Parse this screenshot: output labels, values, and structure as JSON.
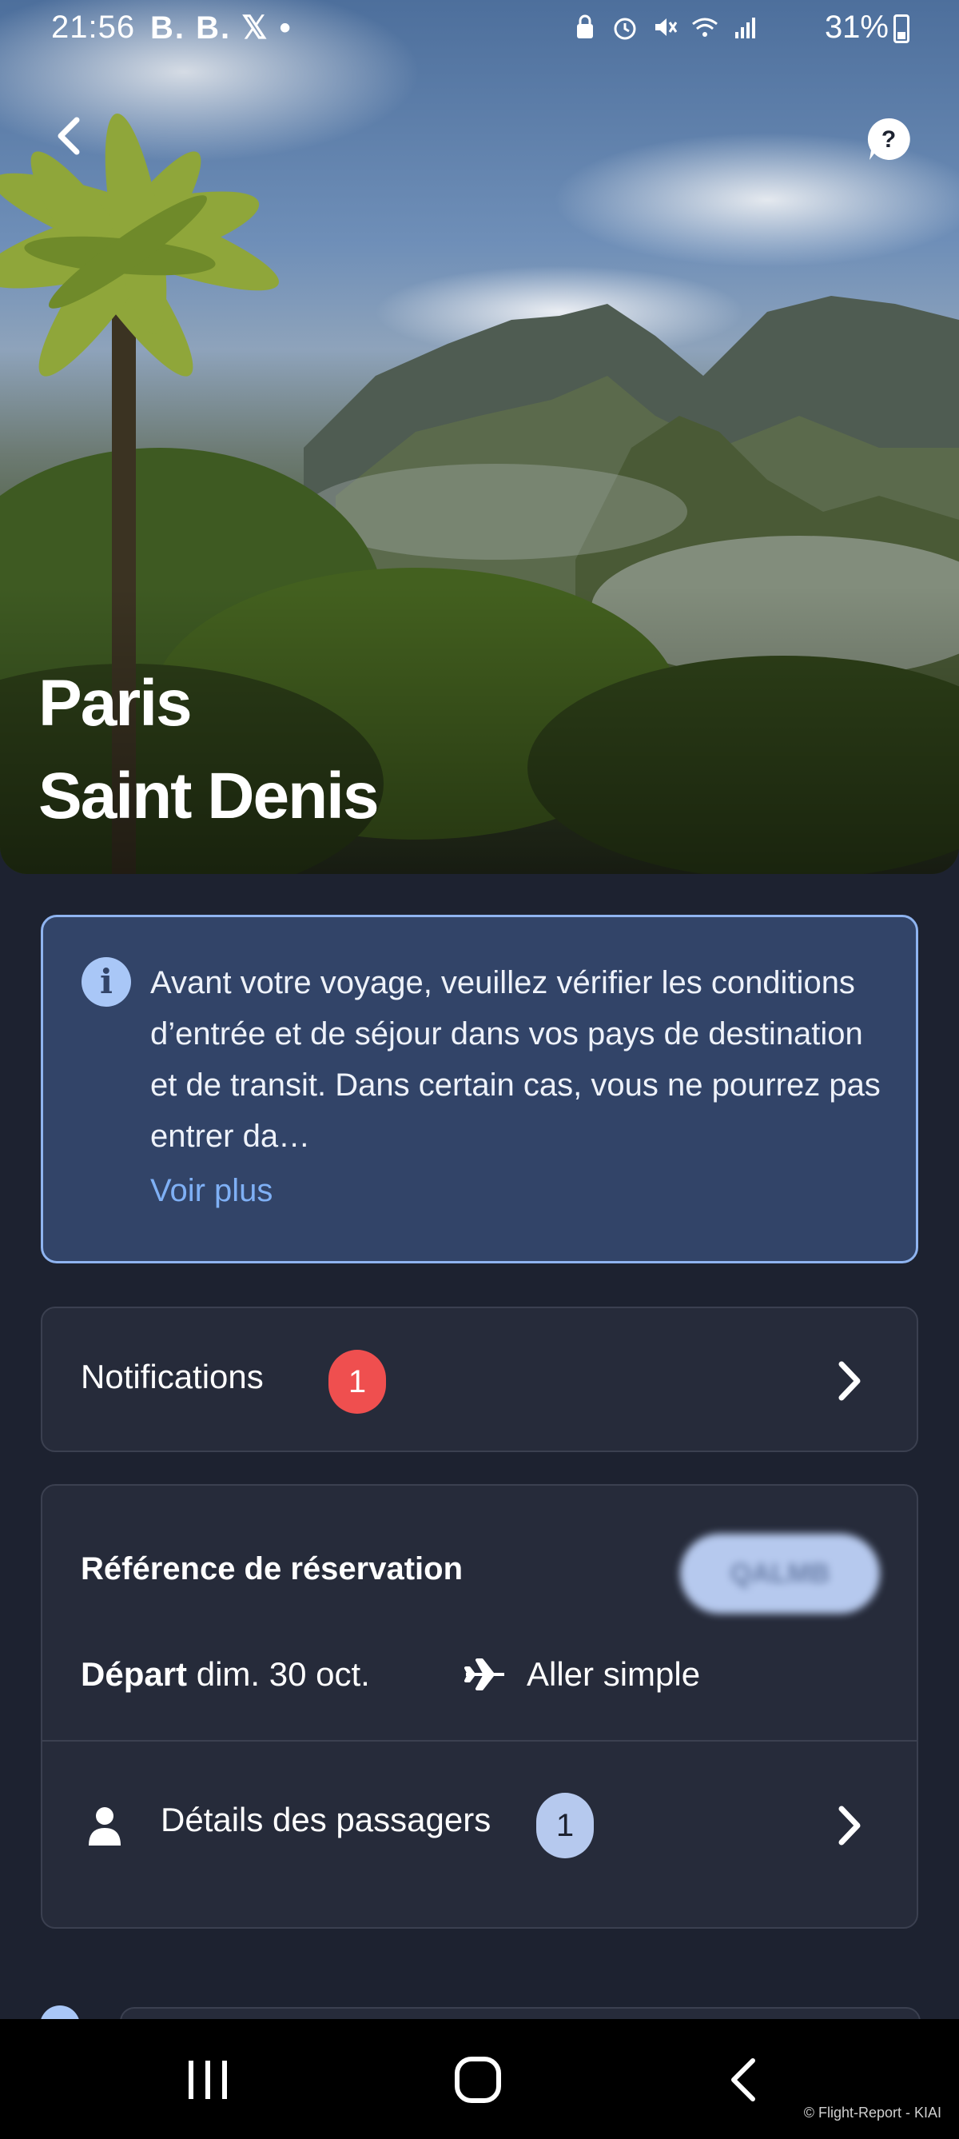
{
  "status_bar": {
    "time": "21:56",
    "app_indicators": "B. B. 𝕏 •",
    "battery": "31%"
  },
  "header": {
    "origin": "Paris",
    "destination": "Saint Denis"
  },
  "info_banner": {
    "text": "Avant votre voyage, veuillez vérifier les conditions d’entrée et de séjour dans vos pays de destination et de transit. Dans certain cas, vous ne pourrez pas entrer da…",
    "link": "Voir plus",
    "accent": "#8fb4f0"
  },
  "notifications": {
    "label": "Notifications",
    "count": "1",
    "badge_color": "#ef4f4f"
  },
  "booking": {
    "reference_label": "Référence de réservation",
    "reference_value": "QALMB",
    "depart_label": "Départ",
    "depart_date": "dim. 30 oct.",
    "trip_type": "Aller simple",
    "passengers_label": "Détails des passagers",
    "passengers_count": "1"
  },
  "footer": {
    "copyright": "© Flight-Report - KIAI"
  },
  "icons": {
    "back": "back-arrow-icon",
    "help": "help-bubble-icon",
    "info": "info-icon",
    "plane": "plane-icon",
    "person": "person-icon",
    "chevron": "chevron-right-icon"
  }
}
